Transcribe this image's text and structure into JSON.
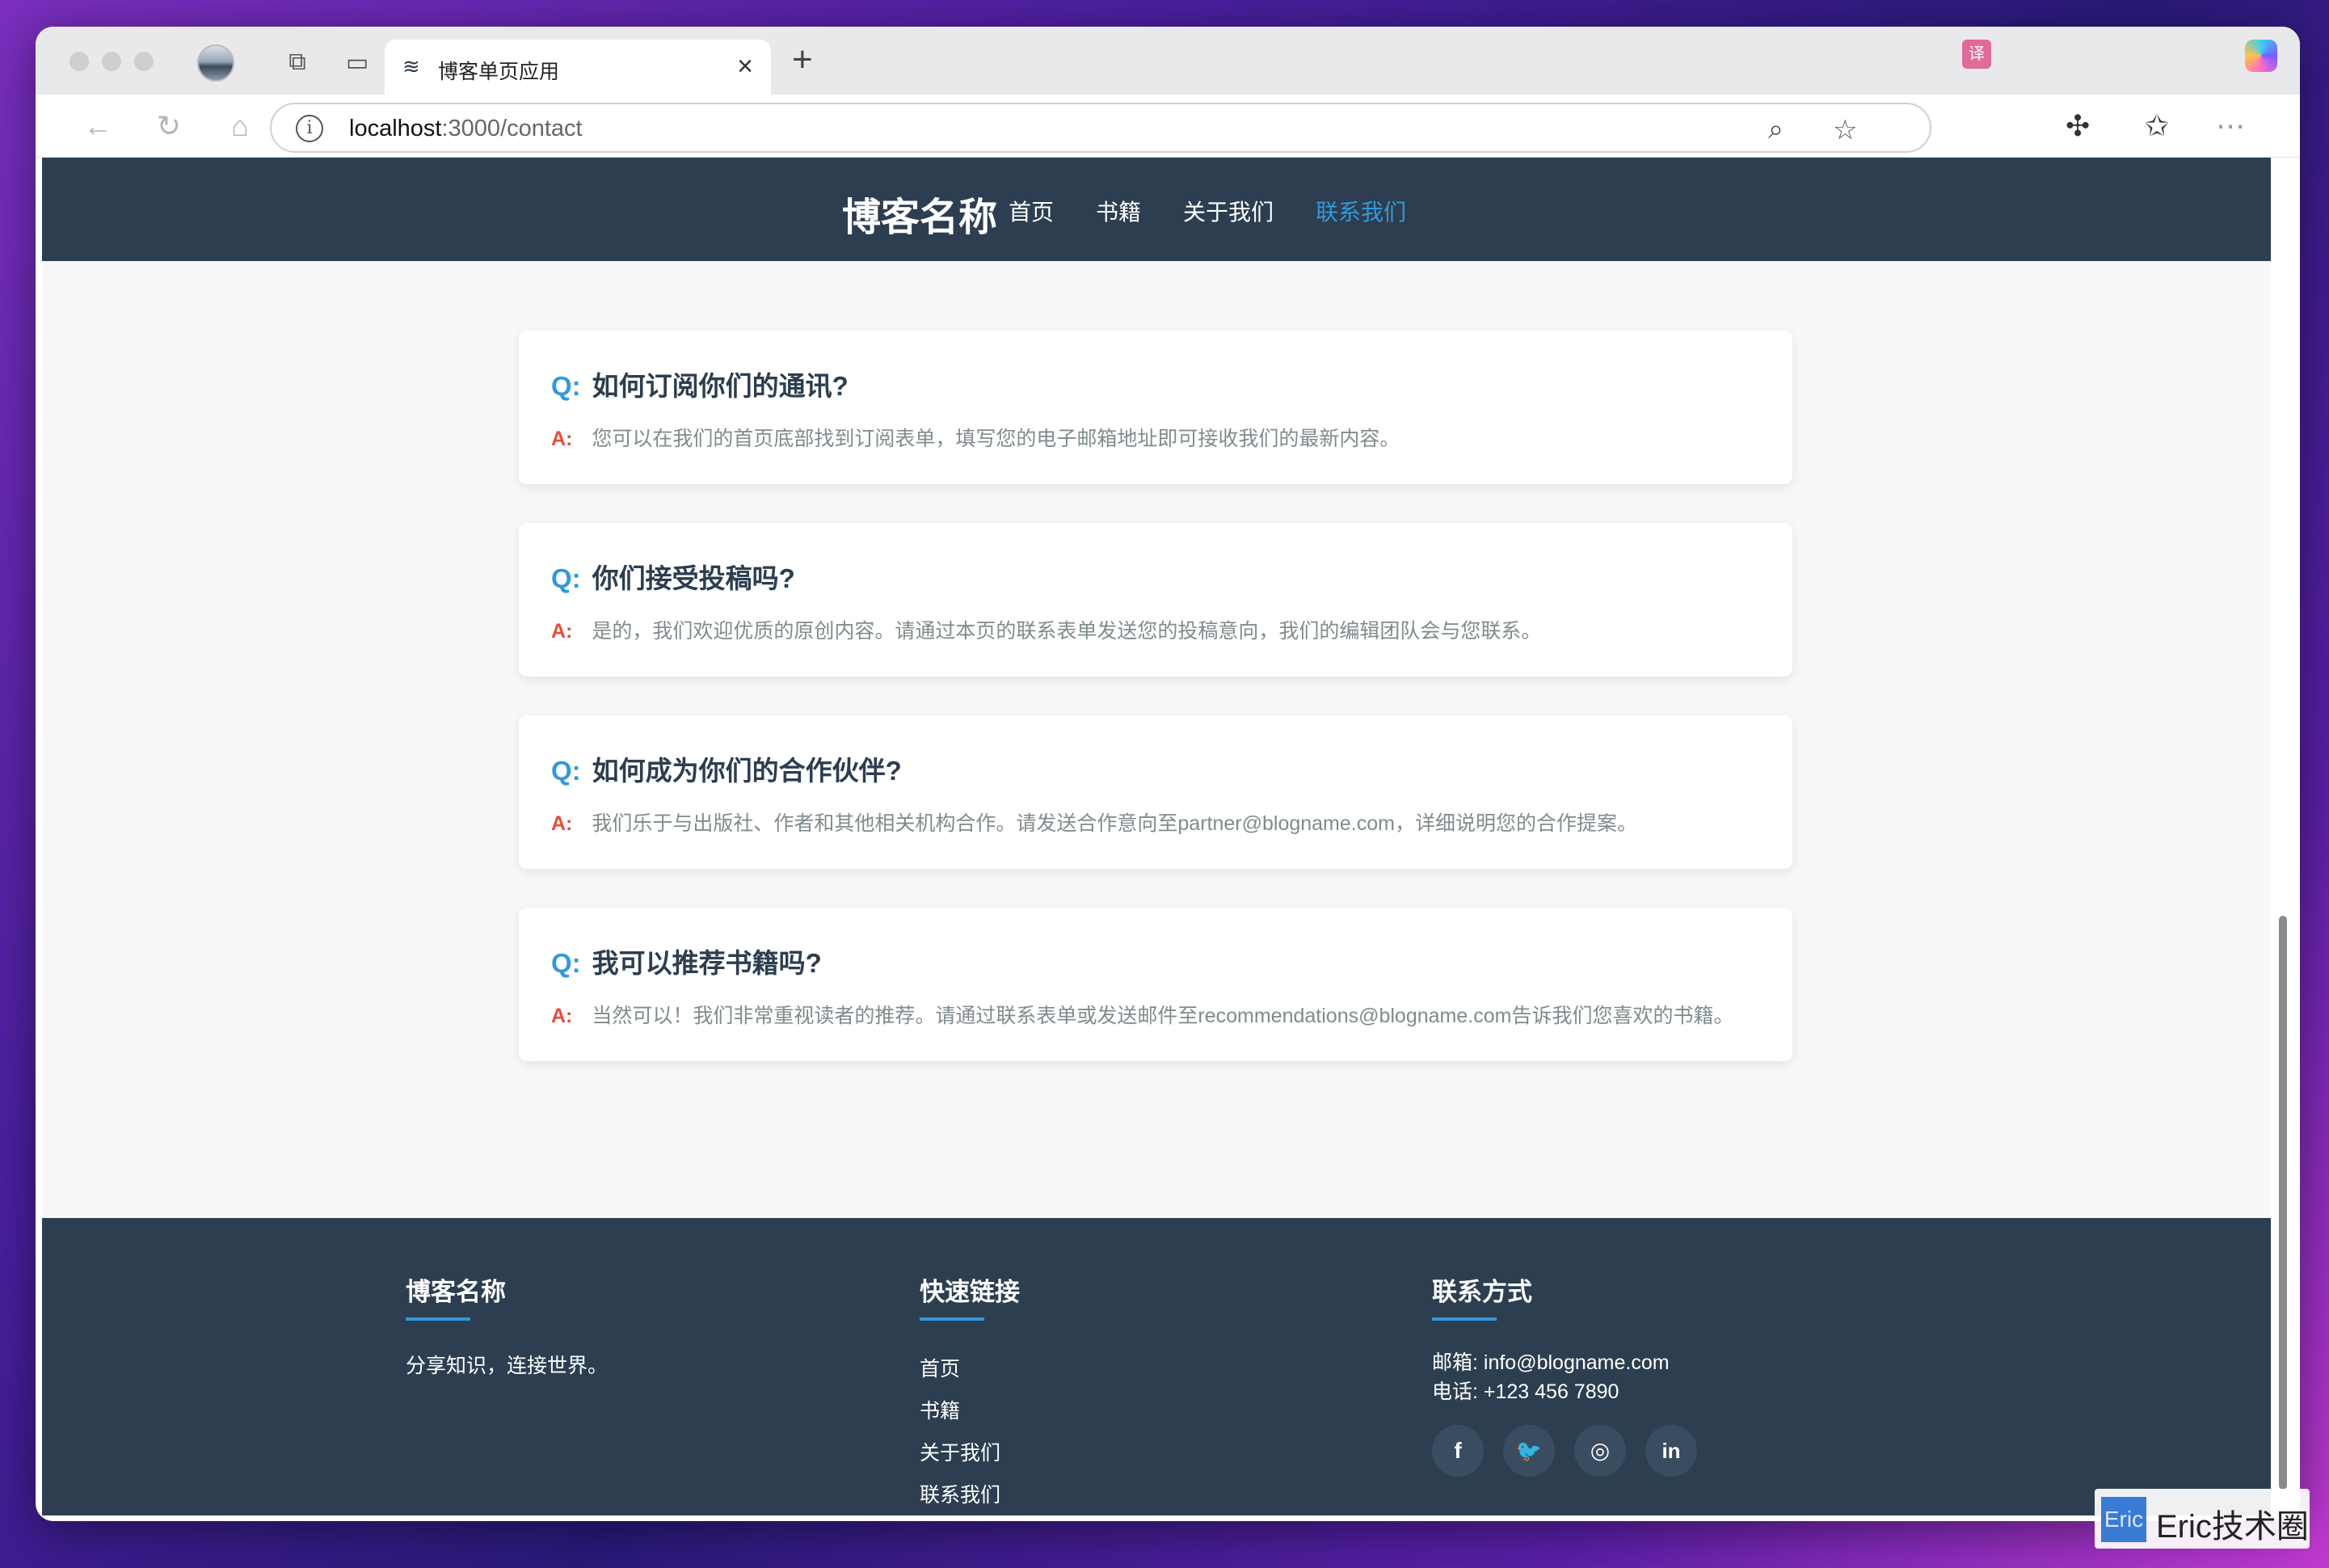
{
  "browser": {
    "tab_title": "博客单页应用",
    "url_host": "localhost",
    "url_path": ":3000/contact"
  },
  "site": {
    "brand": "博客名称",
    "nav": [
      {
        "label": "首页",
        "active": false
      },
      {
        "label": "书籍",
        "active": false
      },
      {
        "label": "关于我们",
        "active": false
      },
      {
        "label": "联系我们",
        "active": true
      }
    ]
  },
  "faq": [
    {
      "q_tag": "Q:",
      "question": "如何订阅你们的通讯?",
      "a_tag": "A:",
      "answer": "您可以在我们的首页底部找到订阅表单，填写您的电子邮箱地址即可接收我们的最新内容。"
    },
    {
      "q_tag": "Q:",
      "question": "你们接受投稿吗?",
      "a_tag": "A:",
      "answer": "是的，我们欢迎优质的原创内容。请通过本页的联系表单发送您的投稿意向，我们的编辑团队会与您联系。"
    },
    {
      "q_tag": "Q:",
      "question": "如何成为你们的合作伙伴?",
      "a_tag": "A:",
      "answer": "我们乐于与出版社、作者和其他相关机构合作。请发送合作意向至partner@blogname.com，详细说明您的合作提案。"
    },
    {
      "q_tag": "Q:",
      "question": "我可以推荐书籍吗?",
      "a_tag": "A:",
      "answer": "当然可以！我们非常重视读者的推荐。请通过联系表单或发送邮件至recommendations@blogname.com告诉我们您喜欢的书籍。"
    }
  ],
  "footer": {
    "about_title": "博客名称",
    "about_text": "分享知识，连接世界。",
    "links_title": "快速链接",
    "links": [
      "首页",
      "书籍",
      "关于我们",
      "联系我们"
    ],
    "contact_title": "联系方式",
    "email": "邮箱: info@blogname.com",
    "phone": "电话: +123 456 7890",
    "social": [
      {
        "glyph": "f",
        "icon": "facebook-icon"
      },
      {
        "glyph": "🐦",
        "icon": "twitter-icon"
      },
      {
        "glyph": "◎",
        "icon": "instagram-icon"
      },
      {
        "glyph": "in",
        "icon": "linkedin-icon"
      }
    ]
  },
  "watermark": {
    "logo": "Eric",
    "text": "Eric技术圈"
  },
  "colors": {
    "header_bg": "#2c3e50",
    "accent": "#3498db",
    "answer_tag": "#e74c3c"
  }
}
